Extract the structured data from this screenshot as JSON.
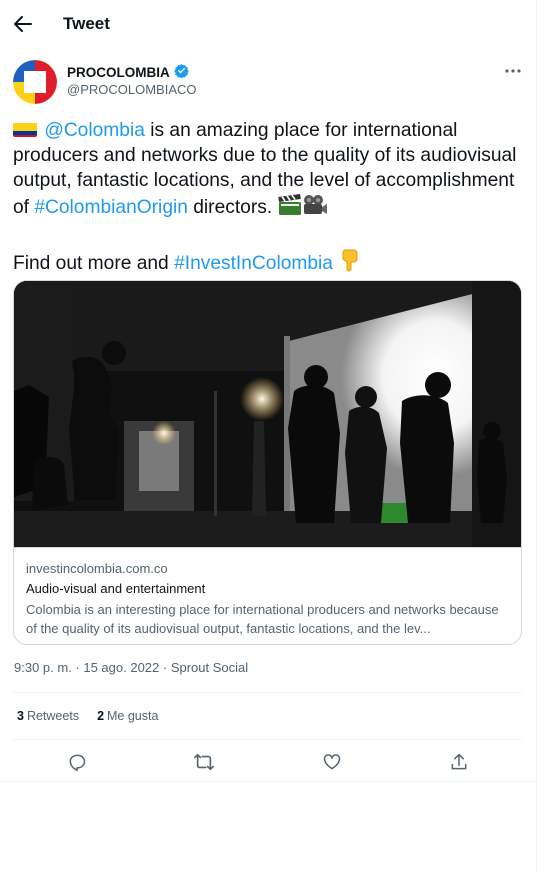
{
  "header": {
    "title": "Tweet",
    "back_icon": "arrow-left-icon"
  },
  "author": {
    "name": "PROCOLOMBIA",
    "handle": "@PROCOLOMBIACO",
    "verified": true,
    "verified_color": "#1d9bf0"
  },
  "tweet": {
    "mention": "@Colombia",
    "text_part1": " is an amazing place for international producers and networks due to the quality of its audiovisual output, fantastic locations, and the level of accomplishment of ",
    "hashtag1": "#ColombianOrigin",
    "text_part2": " directors. ",
    "text_part3": "Find out more and ",
    "hashtag2": "#InvestInColombia",
    "link_color": "#1d9bf0",
    "emojis": [
      "colombia-flag",
      "clapper-board",
      "movie-camera",
      "pointing-down-hand"
    ]
  },
  "card": {
    "domain": "investincolombia.com.co",
    "title": "Audio-visual and entertainment",
    "description": "Colombia is an interesting place for international producers and networks because of the quality of its audiovisual output, fantastic locations, and the lev..."
  },
  "meta": {
    "time_line": "9:30 p. m. · 15 ago. 2022 · Sprout Social"
  },
  "stats": {
    "retweets_count": "3",
    "retweets_label": "Retweets",
    "likes_count": "2",
    "likes_label": "Me gusta"
  },
  "actions": [
    "reply-icon",
    "retweet-icon",
    "like-icon",
    "share-icon"
  ]
}
